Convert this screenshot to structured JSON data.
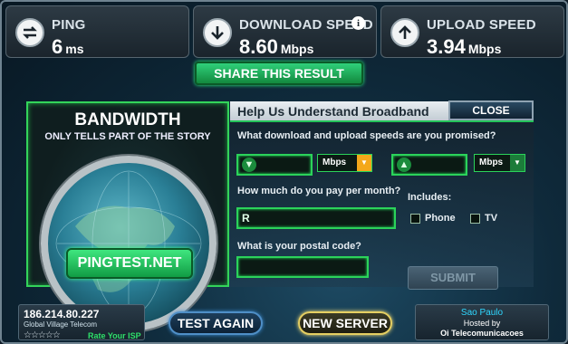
{
  "metrics": {
    "ping": {
      "label": "PING",
      "value": "6",
      "unit": "ms",
      "icon": "ping-arrows-icon"
    },
    "download": {
      "label": "DOWNLOAD SPEED",
      "value": "8.60",
      "unit": "Mbps",
      "icon": "download-arrow-icon"
    },
    "upload": {
      "label": "UPLOAD SPEED",
      "value": "3.94",
      "unit": "Mbps",
      "icon": "upload-arrow-icon"
    }
  },
  "share_label": "SHARE THIS RESULT",
  "bandwidth": {
    "title": "BANDWIDTH",
    "subtitle": "ONLY TELLS PART OF THE STORY",
    "button_label": "PINGTEST.NET"
  },
  "survey": {
    "title": "Help Us Understand Broadband",
    "close_label": "CLOSE",
    "q_speeds": "What download and upload speeds are you promised?",
    "download_unit": "Mbps",
    "upload_unit": "Mbps",
    "q_price": "How much do you pay per month?",
    "price_prefix": "R",
    "includes_label": "Includes:",
    "phone_label": "Phone",
    "tv_label": "TV",
    "q_postal": "What is your postal code?",
    "submit_label": "SUBMIT"
  },
  "client": {
    "ip": "186.214.80.227",
    "isp": "Global Village Telecom",
    "stars": "☆☆☆☆☆",
    "rate_label": "Rate Your ISP"
  },
  "actions": {
    "test_again": "TEST AGAIN",
    "new_server": "NEW SERVER"
  },
  "server": {
    "city": "Sao Paulo",
    "hosted_by": "Hosted by",
    "host": "Oi Telecomunicacoes"
  },
  "colors": {
    "accent_green": "#2bd35a",
    "panel_dark": "#1a242c",
    "server_city": "#2fd7ff",
    "new_server_border": "#e5cf62"
  }
}
